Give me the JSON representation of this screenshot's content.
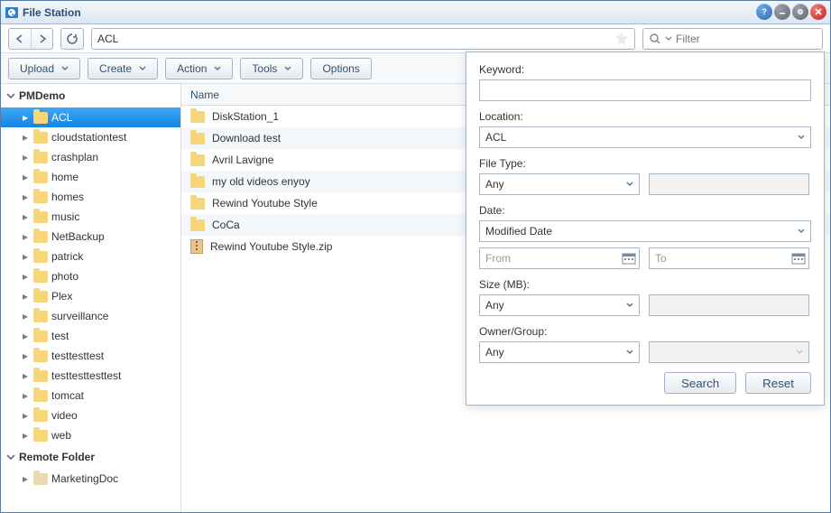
{
  "window": {
    "title": "File Station"
  },
  "path": {
    "value": "ACL"
  },
  "filter": {
    "placeholder": "Filter"
  },
  "toolbar": {
    "upload": "Upload",
    "create": "Create",
    "action": "Action",
    "tools": "Tools",
    "options": "Options"
  },
  "tree": {
    "root": "PMDemo",
    "items": [
      {
        "label": "ACL",
        "selected": true
      },
      {
        "label": "cloudstationtest"
      },
      {
        "label": "crashplan"
      },
      {
        "label": "home"
      },
      {
        "label": "homes"
      },
      {
        "label": "music"
      },
      {
        "label": "NetBackup"
      },
      {
        "label": "patrick"
      },
      {
        "label": "photo"
      },
      {
        "label": "Plex"
      },
      {
        "label": "surveillance"
      },
      {
        "label": "test"
      },
      {
        "label": "testtesttest"
      },
      {
        "label": "testtesttesttest"
      },
      {
        "label": "tomcat"
      },
      {
        "label": "video"
      },
      {
        "label": "web"
      }
    ],
    "remote_header": "Remote Folder",
    "remote_items": [
      {
        "label": "MarketingDoc"
      }
    ]
  },
  "list": {
    "header_name": "Name",
    "rows": [
      {
        "name": "DiskStation_1",
        "icon": "folder"
      },
      {
        "name": "Download test",
        "icon": "folder"
      },
      {
        "name": "Avril Lavigne",
        "icon": "folder"
      },
      {
        "name": "my old videos enyoy",
        "icon": "folder"
      },
      {
        "name": "Rewind Youtube Style",
        "icon": "folder"
      },
      {
        "name": "CoCa",
        "icon": "folder"
      },
      {
        "name": "Rewind Youtube Style.zip",
        "icon": "zip"
      }
    ]
  },
  "search": {
    "keyword_label": "Keyword:",
    "location_label": "Location:",
    "location_value": "ACL",
    "filetype_label": "File Type:",
    "filetype_value": "Any",
    "date_label": "Date:",
    "date_type": "Modified Date",
    "date_from_ph": "From",
    "date_to_ph": "To",
    "size_label": "Size (MB):",
    "size_value": "Any",
    "owner_label": "Owner/Group:",
    "owner_value": "Any",
    "search_btn": "Search",
    "reset_btn": "Reset"
  }
}
